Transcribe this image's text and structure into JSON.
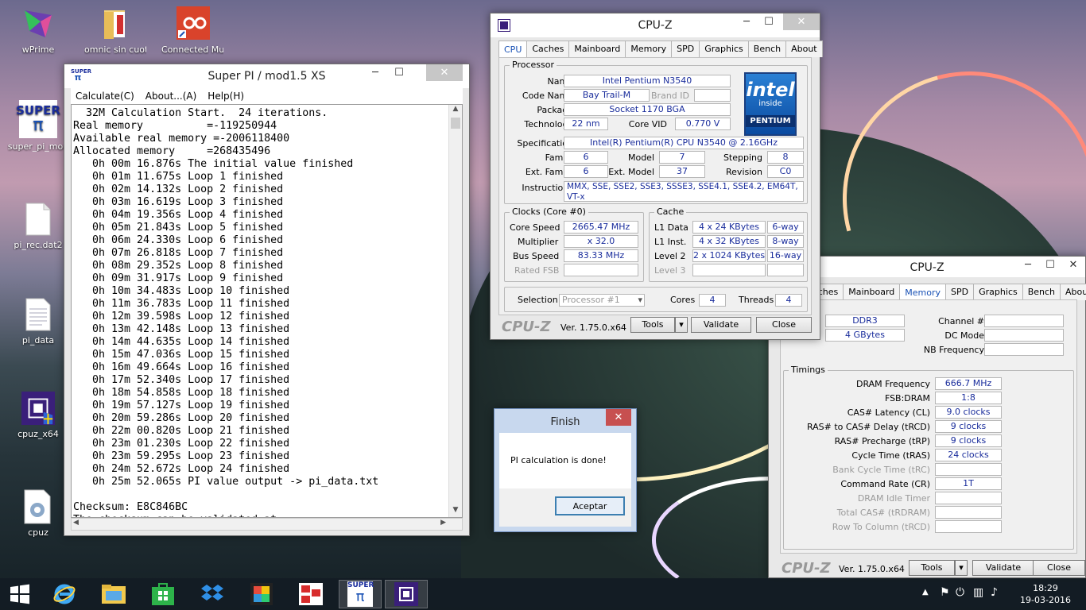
{
  "desktop": {
    "icons": [
      {
        "label": "wPrime",
        "icon": "wprime-icon"
      },
      {
        "label": "omnic sin cuotas",
        "icon": "folder-icon"
      },
      {
        "label": "Connected Music",
        "icon": "music-app-icon"
      },
      {
        "label": "super_pi_mod",
        "icon": "superpi-icon"
      },
      {
        "label": "pi_rec.dat2",
        "icon": "file-icon"
      },
      {
        "label": "pi_data",
        "icon": "text-file-icon"
      },
      {
        "label": "cpuz_x64",
        "icon": "cpuz-icon"
      },
      {
        "label": "cpuz",
        "icon": "settings-file-icon"
      }
    ]
  },
  "superpi": {
    "title": "Super PI / mod1.5 XS",
    "logo_text": "SUPER",
    "menu": [
      "Calculate(C)",
      "About...(A)",
      "Help(H)"
    ],
    "lines": [
      "  32M Calculation Start.  24 iterations.",
      "Real memory          =-119250944",
      "Available real memory =-2006118400",
      "Allocated memory     =268435496",
      "   0h 00m 16.876s The initial value finished",
      "   0h 01m 11.675s Loop 1 finished",
      "   0h 02m 14.132s Loop 2 finished",
      "   0h 03m 16.619s Loop 3 finished",
      "   0h 04m 19.356s Loop 4 finished",
      "   0h 05m 21.843s Loop 5 finished",
      "   0h 06m 24.330s Loop 6 finished",
      "   0h 07m 26.818s Loop 7 finished",
      "   0h 08m 29.352s Loop 8 finished",
      "   0h 09m 31.917s Loop 9 finished",
      "   0h 10m 34.483s Loop 10 finished",
      "   0h 11m 36.783s Loop 11 finished",
      "   0h 12m 39.598s Loop 12 finished",
      "   0h 13m 42.148s Loop 13 finished",
      "   0h 14m 44.635s Loop 14 finished",
      "   0h 15m 47.036s Loop 15 finished",
      "   0h 16m 49.664s Loop 16 finished",
      "   0h 17m 52.340s Loop 17 finished",
      "   0h 18m 54.858s Loop 18 finished",
      "   0h 19m 57.127s Loop 19 finished",
      "   0h 20m 59.286s Loop 20 finished",
      "   0h 22m 00.820s Loop 21 finished",
      "   0h 23m 01.230s Loop 22 finished",
      "   0h 23m 59.295s Loop 23 finished",
      "   0h 24m 52.672s Loop 24 finished",
      "   0h 25m 52.065s PI value output -> pi_data.txt",
      "",
      "Checksum: E8C846BC",
      "The checksum can be validated at"
    ]
  },
  "cpuz1": {
    "title": "CPU-Z",
    "tabs": [
      "CPU",
      "Caches",
      "Mainboard",
      "Memory",
      "SPD",
      "Graphics",
      "Bench",
      "About"
    ],
    "active_tab": "CPU",
    "processor": {
      "group": "Processor",
      "name_label": "Name",
      "name": "Intel Pentium N3540",
      "codename_label": "Code Name",
      "codename": "Bay Trail-M",
      "brandid_label": "Brand ID",
      "brandid": "",
      "package_label": "Package",
      "package": "Socket 1170 BGA",
      "technology_label": "Technology",
      "technology": "22 nm",
      "corevid_label": "Core VID",
      "corevid": "0.770 V",
      "spec_label": "Specification",
      "spec": "Intel(R) Pentium(R) CPU  N3540  @ 2.16GHz",
      "family_label": "Family",
      "family": "6",
      "model_label": "Model",
      "model": "7",
      "stepping_label": "Stepping",
      "stepping": "8",
      "extfamily_label": "Ext. Family",
      "extfamily": "6",
      "extmodel_label": "Ext. Model",
      "extmodel": "37",
      "revision_label": "Revision",
      "revision": "C0",
      "instructions_label": "Instructions",
      "instructions": "MMX, SSE, SSE2, SSE3, SSSE3, SSE4.1, SSE4.2, EM64T, VT-x"
    },
    "intel_logo": {
      "brand": "intel",
      "inside": "inside",
      "product": "PENTIUM"
    },
    "clocks": {
      "group": "Clocks (Core #0)",
      "corespeed_label": "Core Speed",
      "corespeed": "2665.47 MHz",
      "multiplier_label": "Multiplier",
      "multiplier": "x 32.0",
      "busspeed_label": "Bus Speed",
      "busspeed": "83.33 MHz",
      "ratedfsb_label": "Rated FSB",
      "ratedfsb": ""
    },
    "cache": {
      "group": "Cache",
      "l1data_label": "L1 Data",
      "l1data": "4 x 24 KBytes",
      "l1data_way": "6-way",
      "l1inst_label": "L1 Inst.",
      "l1inst": "4 x 32 KBytes",
      "l1inst_way": "8-way",
      "level2_label": "Level 2",
      "level2": "2 x 1024 KBytes",
      "level2_way": "16-way",
      "level3_label": "Level 3",
      "level3": ""
    },
    "selection_label": "Selection",
    "selection": "Processor #1",
    "cores_label": "Cores",
    "cores": "4",
    "threads_label": "Threads",
    "threads": "4",
    "footer": {
      "logo": "CPU-Z",
      "version": "Ver. 1.75.0.x64",
      "tools": "Tools",
      "validate": "Validate",
      "close": "Close"
    }
  },
  "cpuz2": {
    "title": "CPU-Z",
    "tabs": [
      "aches",
      "Mainboard",
      "Memory",
      "SPD",
      "Graphics",
      "Bench",
      "About"
    ],
    "active_tab": "Memory",
    "type": "DDR3",
    "size": "4 GBytes",
    "channel_label": "Channel #",
    "dcmode_label": "DC Mode",
    "nbfreq_label": "NB Frequency",
    "timings_group": "Timings",
    "timings": [
      {
        "label": "DRAM Frequency",
        "value": "666.7 MHz",
        "dim": false
      },
      {
        "label": "FSB:DRAM",
        "value": "1:8",
        "dim": false
      },
      {
        "label": "CAS# Latency (CL)",
        "value": "9.0 clocks",
        "dim": false
      },
      {
        "label": "RAS# to CAS# Delay (tRCD)",
        "value": "9 clocks",
        "dim": false
      },
      {
        "label": "RAS# Precharge (tRP)",
        "value": "9 clocks",
        "dim": false
      },
      {
        "label": "Cycle Time (tRAS)",
        "value": "24 clocks",
        "dim": false
      },
      {
        "label": "Bank Cycle Time (tRC)",
        "value": "",
        "dim": true
      },
      {
        "label": "Command Rate (CR)",
        "value": "1T",
        "dim": false
      },
      {
        "label": "DRAM Idle Timer",
        "value": "",
        "dim": true
      },
      {
        "label": "Total CAS# (tRDRAM)",
        "value": "",
        "dim": true
      },
      {
        "label": "Row To Column (tRCD)",
        "value": "",
        "dim": true
      }
    ],
    "footer": {
      "logo": "CPU-Z",
      "version": "Ver. 1.75.0.x64",
      "tools": "Tools",
      "validate": "Validate",
      "close": "Close"
    }
  },
  "finish_dialog": {
    "title": "Finish",
    "message": "PI calculation is done!",
    "ok": "Aceptar"
  },
  "taskbar": {
    "apps": [
      "windows-start-icon",
      "internet-explorer-icon",
      "file-explorer-icon",
      "store-icon",
      "dropbox-icon",
      "photo-app-icon",
      "remote-app-icon",
      "superpi-icon",
      "cpuz-icon"
    ],
    "tray": {
      "time": "18:29",
      "date": "19-03-2016"
    }
  },
  "colors": {
    "value_text": "#1a2d9c",
    "tab_active": "#1a52b5",
    "close_red": "#c75050"
  }
}
